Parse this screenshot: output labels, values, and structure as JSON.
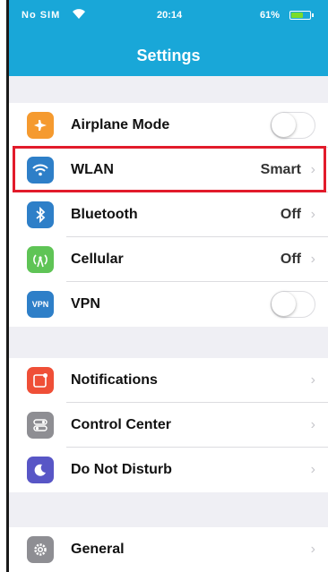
{
  "status_bar": {
    "carrier": "No SIM",
    "time": "20:14",
    "battery": "61%",
    "battery_level": 0.61
  },
  "header": {
    "title": "Settings",
    "color": "#19a7d8"
  },
  "groups": [
    {
      "rows": [
        {
          "label": "Airplane Mode",
          "icon": "airplane-icon",
          "icon_color": "#f59a2f",
          "control": "toggle",
          "toggle_on": false
        },
        {
          "label": "WLAN",
          "icon": "wifi-icon",
          "icon_color": "#2e7fc8",
          "value": "Smart",
          "control": "chevron",
          "highlighted": true
        },
        {
          "label": "Bluetooth",
          "icon": "bluetooth-icon",
          "icon_color": "#2e7fc8",
          "value": "Off",
          "control": "chevron"
        },
        {
          "label": "Cellular",
          "icon": "cellular-icon",
          "icon_color": "#5fc456",
          "value": "Off",
          "control": "chevron"
        },
        {
          "label": "VPN",
          "icon": "vpn-icon",
          "icon_color": "#2e7fc8",
          "icon_text": "VPN",
          "control": "toggle",
          "toggle_on": false
        }
      ]
    },
    {
      "rows": [
        {
          "label": "Notifications",
          "icon": "notifications-icon",
          "icon_color": "#ef4f37",
          "control": "chevron"
        },
        {
          "label": "Control Center",
          "icon": "control-center-icon",
          "icon_color": "#8e8e93",
          "control": "chevron"
        },
        {
          "label": "Do Not Disturb",
          "icon": "moon-icon",
          "icon_color": "#5856c6",
          "control": "chevron"
        }
      ]
    },
    {
      "rows": [
        {
          "label": "General",
          "icon": "gear-icon",
          "icon_color": "#8e8e93",
          "control": "chevron"
        }
      ]
    }
  ],
  "highlight_color": "#e21b2b"
}
